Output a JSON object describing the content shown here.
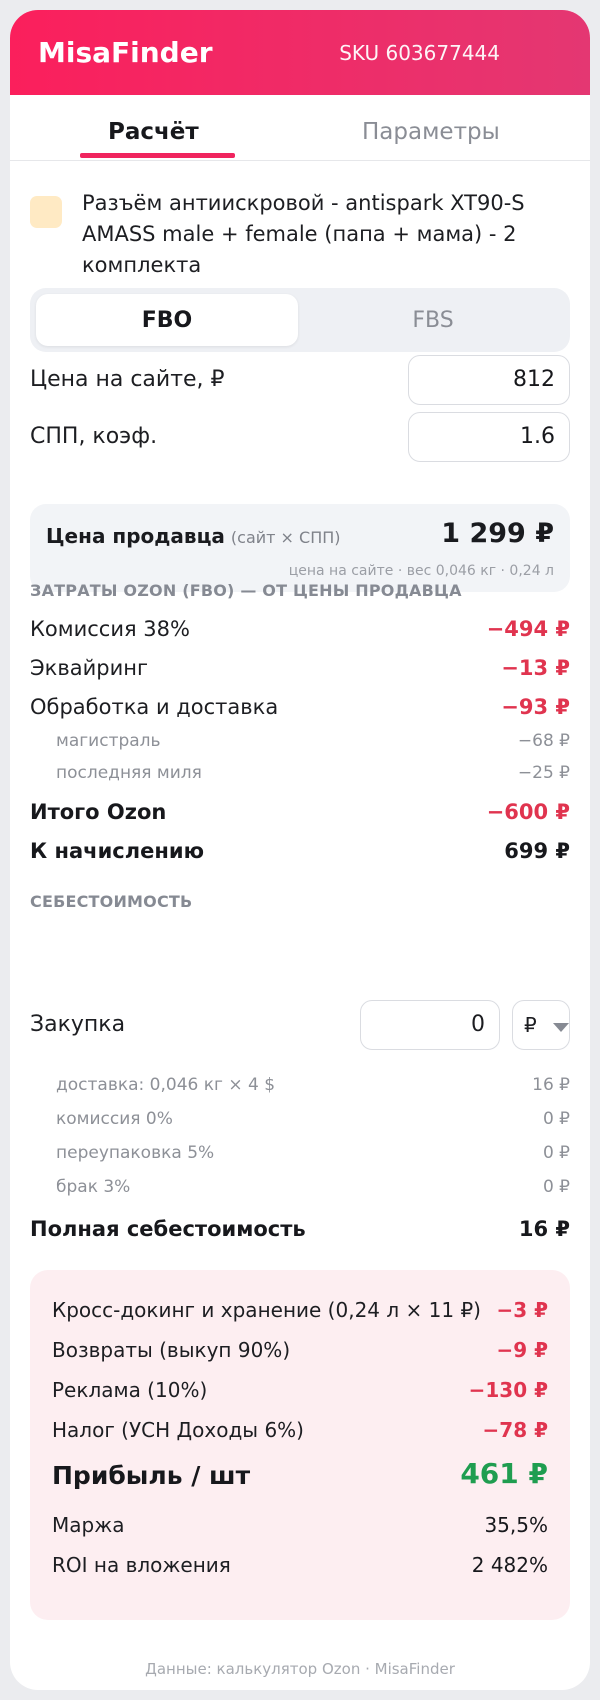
{
  "header": {
    "brand": "MisaFinder",
    "sku": "SKU 603677444"
  },
  "tabs": {
    "active": "Расчёт",
    "inactive": "Параметры"
  },
  "product": {
    "name": "Разъём антиискровой - antispark XT90-S AMASS male + female (папа + мама) - 2 комплекта"
  },
  "mode": {
    "fbo": "FBO",
    "fbs": "FBS"
  },
  "inputs": {
    "price_label": "Цена на сайте, ₽",
    "price_value": "812",
    "spp_label": "СПП, коэф.",
    "spp_value": "1.6"
  },
  "seller": {
    "title": "Цена продавца",
    "hint": "(сайт × СПП)",
    "value": "1 299 ₽",
    "sub": "цена на сайте · вес 0,046 кг · 0,24 л"
  },
  "ozon_costs": {
    "heading": "ЗАТРАТЫ OZON (FBO) — ОТ ЦЕНЫ ПРОДАВЦА",
    "commission_label": "Комиссия 38%",
    "commission_value": "−494 ₽",
    "acquiring_label": "Эквайринг",
    "acquiring_value": "−13 ₽",
    "delivery_label": "Обработка и доставка",
    "delivery_value": "−93 ₽",
    "trunk_label": "магистраль",
    "trunk_value": "−68 ₽",
    "lastmile_label": "последняя миля",
    "lastmile_value": "−25 ₽",
    "total_label": "Итого Ozon",
    "total_value": "−600 ₽",
    "payout_label": "К начислению",
    "payout_value": "699 ₽"
  },
  "cost": {
    "heading": "СЕБЕСТОИМОСТЬ",
    "purchase_label": "Закупка",
    "purchase_value": "0",
    "currency": "₽",
    "shipping_label": "доставка: 0,046 кг × 4 $",
    "shipping_value": "16 ₽",
    "commission_label": "комиссия 0%",
    "commission_value": "0 ₽",
    "repack_label": "переупаковка 5%",
    "repack_value": "0 ₽",
    "defect_label": "брак 3%",
    "defect_value": "0 ₽",
    "full_label": "Полная себестоимость",
    "full_value": "16 ₽"
  },
  "profit": {
    "crossdock_label": "Кросс-докинг и хранение (0,24 л × 11 ₽)",
    "crossdock_value": "−3 ₽",
    "returns_label": "Возвраты (выкуп 90%)",
    "returns_value": "−9 ₽",
    "ads_label": "Реклама (10%)",
    "ads_value": "−130 ₽",
    "tax_label": "Налог (УСН Доходы 6%)",
    "tax_value": "−78 ₽",
    "profit_label": "Прибыль / шт",
    "profit_value": "461 ₽",
    "margin_label": "Маржа",
    "margin_value": "35,5%",
    "roi_label": "ROI на вложения",
    "roi_value": "2 482%"
  },
  "footer": {
    "text": "Данные: калькулятор Ozon · MisaFinder"
  },
  "colors": {
    "brand": "#fb1f5c",
    "negative": "#e0344f",
    "positive": "#1f9d50"
  }
}
